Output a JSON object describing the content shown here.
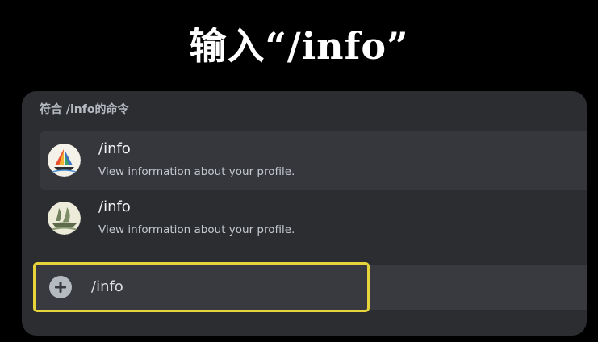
{
  "heading": "输入“/info”",
  "panel": {
    "header": "符合 /info的命令",
    "items": [
      {
        "name": "/info",
        "description": "View information about your profile.",
        "avatar_icon": "sailboat-bot-avatar-icon"
      },
      {
        "name": "/info",
        "description": "View information about your profile.",
        "avatar_icon": "junk-ship-bot-avatar-icon"
      }
    ]
  },
  "input": {
    "value": "/info",
    "add_icon": "plus-circle-icon"
  },
  "colors": {
    "highlight": "#e6d43a",
    "panel_bg": "#2b2d31",
    "active_item_bg": "#36373d",
    "input_bg": "#383a40"
  }
}
